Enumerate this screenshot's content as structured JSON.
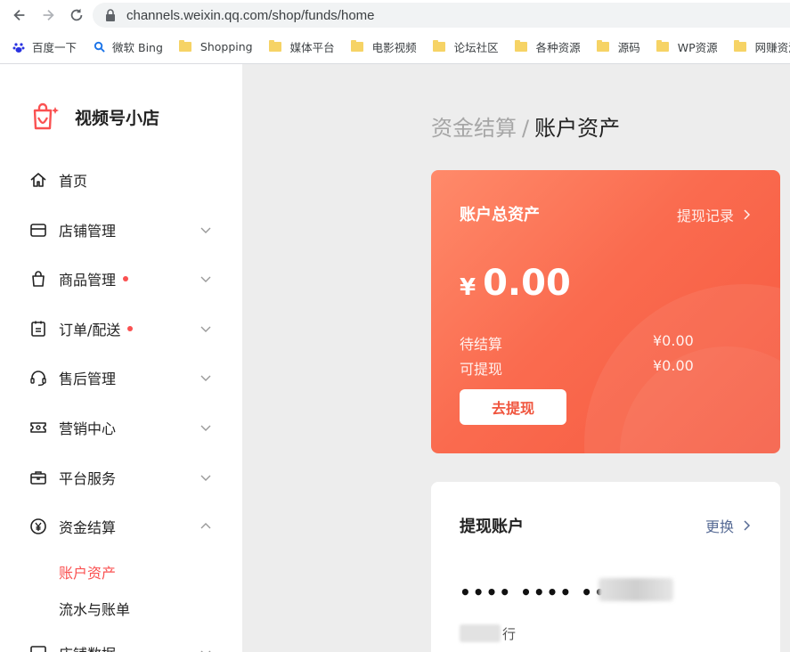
{
  "browser": {
    "url": "channels.weixin.qq.com/shop/funds/home",
    "bookmarks": [
      {
        "label": "百度一下",
        "icon": "baidu-icon"
      },
      {
        "label": "微软 Bing",
        "icon": "bing-search-icon"
      },
      {
        "label": "Shopping",
        "icon": "folder-icon"
      },
      {
        "label": "媒体平台",
        "icon": "folder-icon"
      },
      {
        "label": "电影视频",
        "icon": "folder-icon"
      },
      {
        "label": "论坛社区",
        "icon": "folder-icon"
      },
      {
        "label": "各种资源",
        "icon": "folder-icon"
      },
      {
        "label": "源码",
        "icon": "folder-icon"
      },
      {
        "label": "WP资源",
        "icon": "folder-icon"
      },
      {
        "label": "网赚资源",
        "icon": "folder-icon"
      }
    ]
  },
  "brand": {
    "name": "视频号小店",
    "logo_color": "#fa5151"
  },
  "sidebar": {
    "items": [
      {
        "label": "首页",
        "icon": "home-icon",
        "dot": false,
        "chevron": "none"
      },
      {
        "label": "店铺管理",
        "icon": "store-icon",
        "dot": false,
        "chevron": "down"
      },
      {
        "label": "商品管理",
        "icon": "shopping-bag-icon",
        "dot": true,
        "chevron": "down"
      },
      {
        "label": "订单/配送",
        "icon": "order-clipboard-icon",
        "dot": true,
        "chevron": "down"
      },
      {
        "label": "售后管理",
        "icon": "headset-icon",
        "dot": false,
        "chevron": "down"
      },
      {
        "label": "营销中心",
        "icon": "ticket-icon",
        "dot": false,
        "chevron": "down"
      },
      {
        "label": "平台服务",
        "icon": "briefcase-icon",
        "dot": false,
        "chevron": "down"
      },
      {
        "label": "资金结算",
        "icon": "yen-circle-icon",
        "dot": false,
        "chevron": "up"
      }
    ],
    "sub_items": [
      {
        "label": "账户资产",
        "active": true
      },
      {
        "label": "流水与账单",
        "active": false
      }
    ],
    "partial_item": {
      "label": "店铺数据"
    }
  },
  "breadcrumb": {
    "parent": "资金结算",
    "separator": "/",
    "current": "账户资产"
  },
  "asset_card": {
    "title": "账户总资产",
    "history_link": "提现记录",
    "currency": "¥",
    "total": "0.00",
    "rows": [
      {
        "label": "待结算",
        "value": "¥0.00"
      },
      {
        "label": "可提现",
        "value": "¥0.00"
      }
    ],
    "withdraw_button": "去提现"
  },
  "withdraw_account": {
    "title": "提现账户",
    "change_link": "更换",
    "card_mask": "•••• •••• ••••",
    "bank_suffix": "行"
  },
  "colors": {
    "accent": "#fa5151",
    "card_gradient_start": "#ff8a6a",
    "card_gradient_end": "#f6593f",
    "link_blue": "#576b95"
  }
}
